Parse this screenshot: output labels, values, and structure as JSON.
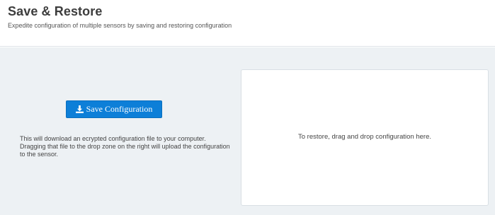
{
  "header": {
    "title": "Save & Restore",
    "subtitle": "Expedite configuration of multiple sensors by saving and restoring configuration"
  },
  "save": {
    "button_label": "Save Configuration",
    "button_icon": "download-icon",
    "description": "This will download an ecrypted configuration file to your computer. Dragging that file to the drop zone on the right will upload the configuration to the sensor."
  },
  "restore": {
    "drop_text": "To restore, drag and drop configuration here."
  },
  "colors": {
    "accent": "#0d7fd8",
    "background": "#edf1f4"
  }
}
